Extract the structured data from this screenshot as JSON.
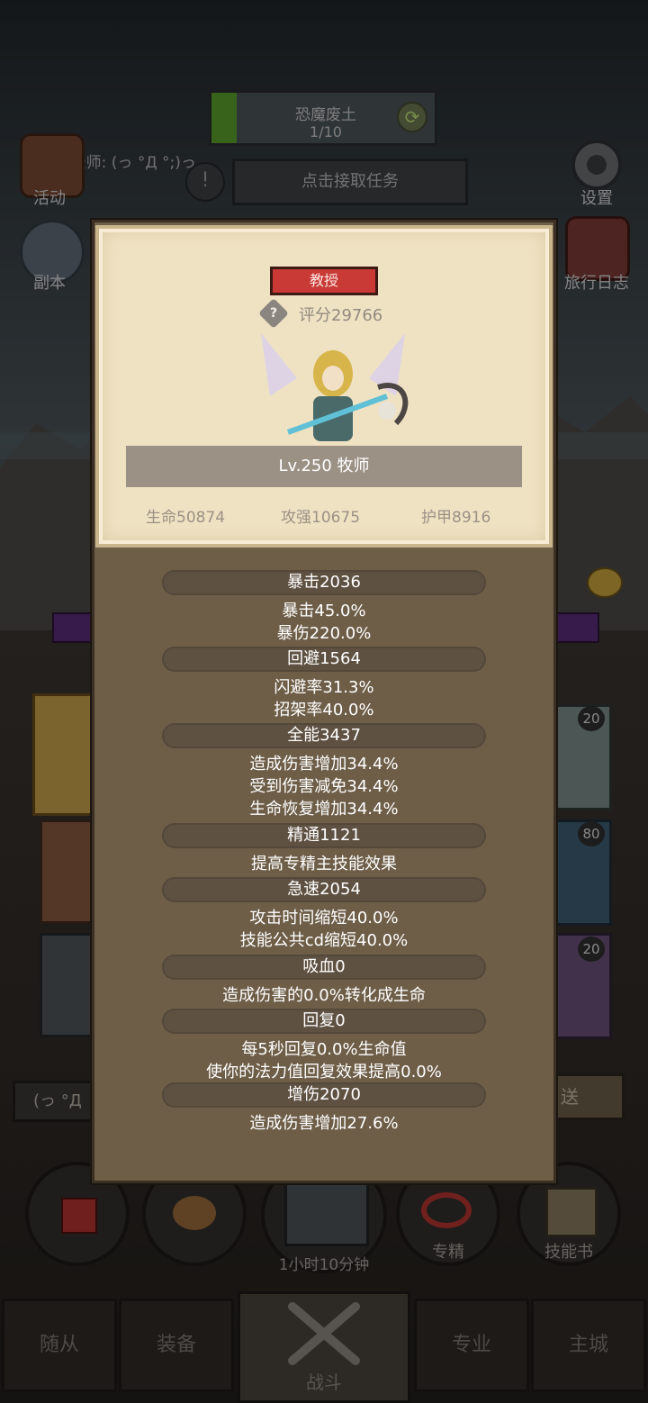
{
  "zone": {
    "name": "恐魔废土",
    "progress": "1/10"
  },
  "task": {
    "label": "点击接取任务"
  },
  "player": {
    "line": "Lv.17 法师: (っ °Д °;)っ"
  },
  "left_menu": [
    {
      "label": "活动",
      "icon": "activity-icon"
    },
    {
      "label": "副本",
      "icon": "dungeon-icon"
    }
  ],
  "right_menu": [
    {
      "label": "设置",
      "icon": "gear-icon"
    },
    {
      "label": "旅行日志",
      "icon": "journal-icon"
    }
  ],
  "badges": {
    "slot1": "20",
    "slot2": "80",
    "slot3": "20"
  },
  "chat": {
    "left_text": "(っ °Д",
    "right_text": "送"
  },
  "bottom_actions": {
    "timer": "1小时10分钟",
    "specialize": "专精",
    "skillbook": "技能书"
  },
  "nav": {
    "followers": "随从",
    "equipment": "装备",
    "battle": "战斗",
    "profession": "专业",
    "city": "主城"
  },
  "hero": {
    "rank": "教授",
    "score": "评分29766",
    "level_class": "Lv.250 牧师",
    "hp": "生命50874",
    "attack": "攻强10675",
    "armor": "护甲8916"
  },
  "stats": [
    {
      "title": "暴击2036",
      "lines": [
        "暴击45.0%",
        "暴伤220.0%"
      ]
    },
    {
      "title": "回避1564",
      "lines": [
        "闪避率31.3%",
        "招架率40.0%"
      ]
    },
    {
      "title": "全能3437",
      "lines": [
        "造成伤害增加34.4%",
        "受到伤害减免34.4%",
        "生命恢复增加34.4%"
      ]
    },
    {
      "title": "精通1121",
      "lines": [
        "提高专精主技能效果"
      ]
    },
    {
      "title": "急速2054",
      "lines": [
        "攻击时间缩短40.0%",
        "技能公共cd缩短40.0%"
      ]
    },
    {
      "title": "吸血0",
      "lines": [
        "造成伤害的0.0%转化成生命"
      ]
    },
    {
      "title": "回复0",
      "lines": [
        "每5秒回复0.0%生命值",
        "使你的法力值回复效果提高0.0%"
      ]
    },
    {
      "title": "增伤2070",
      "lines": [
        "造成伤害增加27.6%"
      ]
    }
  ],
  "colors": {
    "rank_red": "#c93a36",
    "modal_brown": "#6e5e48",
    "card_parchment": "#efe2c3"
  }
}
